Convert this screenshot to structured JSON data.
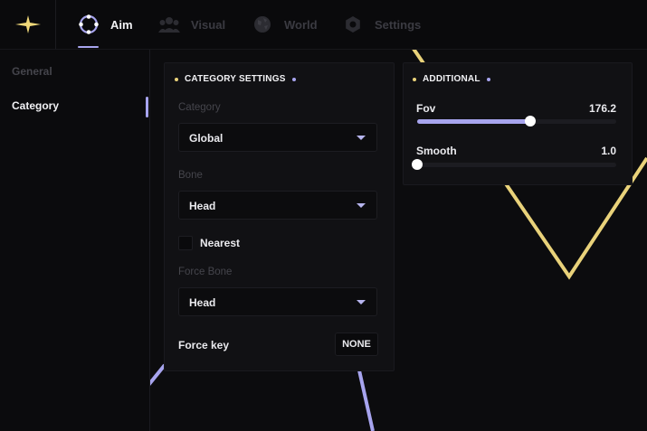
{
  "colors": {
    "accent": "#a7a4ee",
    "gold": "#e9d27a",
    "background": "#0c0c0e",
    "panel": "#111114"
  },
  "nav": {
    "logo_icon": "star-sparkle-icon",
    "tabs": [
      {
        "label": "Aim",
        "icon": "crosshair-icon",
        "active": true
      },
      {
        "label": "Visual",
        "icon": "users-icon",
        "active": false
      },
      {
        "label": "World",
        "icon": "globe-icon",
        "active": false
      },
      {
        "label": "Settings",
        "icon": "gear-icon",
        "active": false
      }
    ]
  },
  "sidebar": {
    "items": [
      {
        "label": "General",
        "active": false
      },
      {
        "label": "Category",
        "active": true
      }
    ]
  },
  "category_panel": {
    "title": "CATEGORY SETTINGS",
    "category_label": "Category",
    "category_value": "Global",
    "bone_label": "Bone",
    "bone_value": "Head",
    "nearest_label": "Nearest",
    "nearest_checked": false,
    "force_bone_label": "Force Bone",
    "force_bone_value": "Head",
    "force_key_label": "Force key",
    "force_key_value": "NONE"
  },
  "additional_panel": {
    "title": "ADDITIONAL",
    "fov_label": "Fov",
    "fov_value": "176.2",
    "fov_fraction": 0.57,
    "smooth_label": "Smooth",
    "smooth_value": "1.0",
    "smooth_fraction": 0.0
  }
}
